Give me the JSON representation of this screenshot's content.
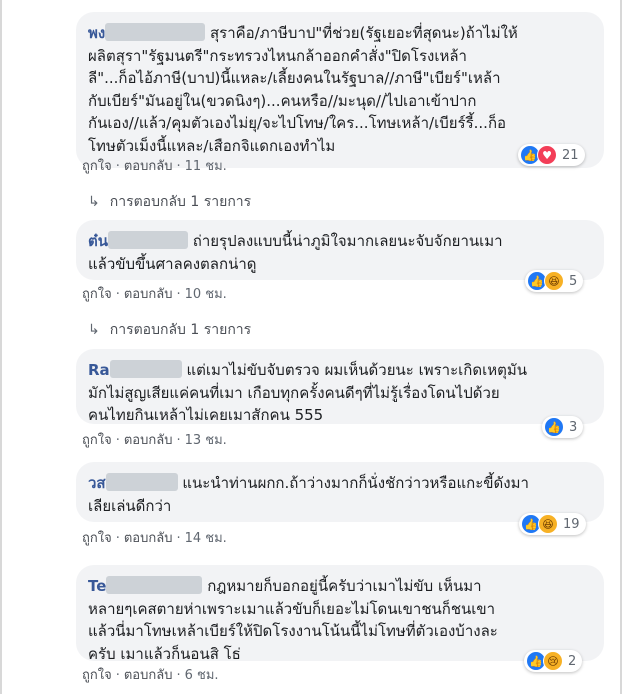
{
  "comments": [
    {
      "name": "พง",
      "text_line1": " สุราคือ/ภาษีบาป\"ที่ช่วย(รัฐเยอะที่สุดนะ)ถ้าไม่ให้",
      "text_rest": "ผลิตสุรา\"รัฐมนตรี\"กระทรวงไหนกล้าออกคำสั่ง\"ปิดโรงเหล้า\nลี\"...ก็อไอ้ภาษี(บาป)นี้แหละ/เลี้ยงคนในรัฐบาล//ภาษี\"เบียร์\"เหล้า\nกับเบียร์\"มันอยู่ใน(ขวดนิงๆ)...คนหรือ//มะนุด//ไปเอาเข้าปาก\nกันเอง//แล้ว/คุมตัวเองไม่ยุ/จะไปโทษ/ใคร...โทษเหล้า/เบียร์รี้...ก็อ\nโทษตัวเม็งนี้แหละ/เสือกจิแดกเองทำไม",
      "like": "ถูกใจ",
      "reply": "ตอบกลับ",
      "time": "11 ชม.",
      "reaction_count": "21"
    },
    {
      "name": "ต๋น",
      "text_line1": " ถ่ายรุปลงแบบนี้น่าภูมิใจมากเลยนะจับจักยานเมา",
      "text_rest": "แล้วขับขึ้นศาลคงตลกน่าดู",
      "like": "ถูกใจ",
      "reply": "ตอบกลับ",
      "time": "10 ชม.",
      "reaction_count": "5"
    },
    {
      "name": "Ra",
      "text_line1": " แต่เมาไม่ขับจับตรวจ ผมเห็นด้วยนะ เพราะเกิดเหตุมัน",
      "text_rest": "มักไม่สูญเสียแค่คนที่เมา เกือบทุกครั้งคนดีๆที่ไม่รู้เรื่องโดนไปด้วย\nคนไทยกินเหล้าไม่เคยเมาสักคน 555",
      "like": "ถูกใจ",
      "reply": "ตอบกลับ",
      "time": "13 ชม.",
      "reaction_count": "3"
    },
    {
      "name": "วส",
      "text_line1": " แนะนำท่านผกก.ถ้าว่างมากก็นั่งชักว่าวหรือแกะขี้ดังมา",
      "text_rest": "เลียเล่นดีกว่า",
      "like": "ถูกใจ",
      "reply": "ตอบกลับ",
      "time": "14 ชม.",
      "reaction_count": "19"
    },
    {
      "name": "Te",
      "text_line1": " กฎหมายก็บอกอยู่นี้ครับว่าเมาไม่ขับ เห็นมา",
      "text_rest": "หลายๆเคสตายห่าเพราะเมาแล้วขับก็เยอะไม่โดนเขาชนก็ชนเขา\nแล้วนี่มาโทษเหล้าเบียร์ให้ปิดโรงงานโน้นนี้ไม่โทษที่ตัวเองบ้างละ\nครับ เมาแล้วก็นอนสิ โธ่",
      "like": "ถูกใจ",
      "reply": "ตอบกลับ",
      "time": "6 ชม.",
      "reaction_count": "2"
    }
  ],
  "replies_links": [
    {
      "label": "การตอบกลับ 1 รายการ"
    },
    {
      "label": "การตอบกลับ 1 รายการ"
    }
  ],
  "reply_arrow": "↳",
  "colors": {
    "bubble": "#f2f3f5",
    "name": "#385898",
    "like": "#2078f4",
    "love": "#f33e58",
    "emoji": "#f7b125"
  }
}
